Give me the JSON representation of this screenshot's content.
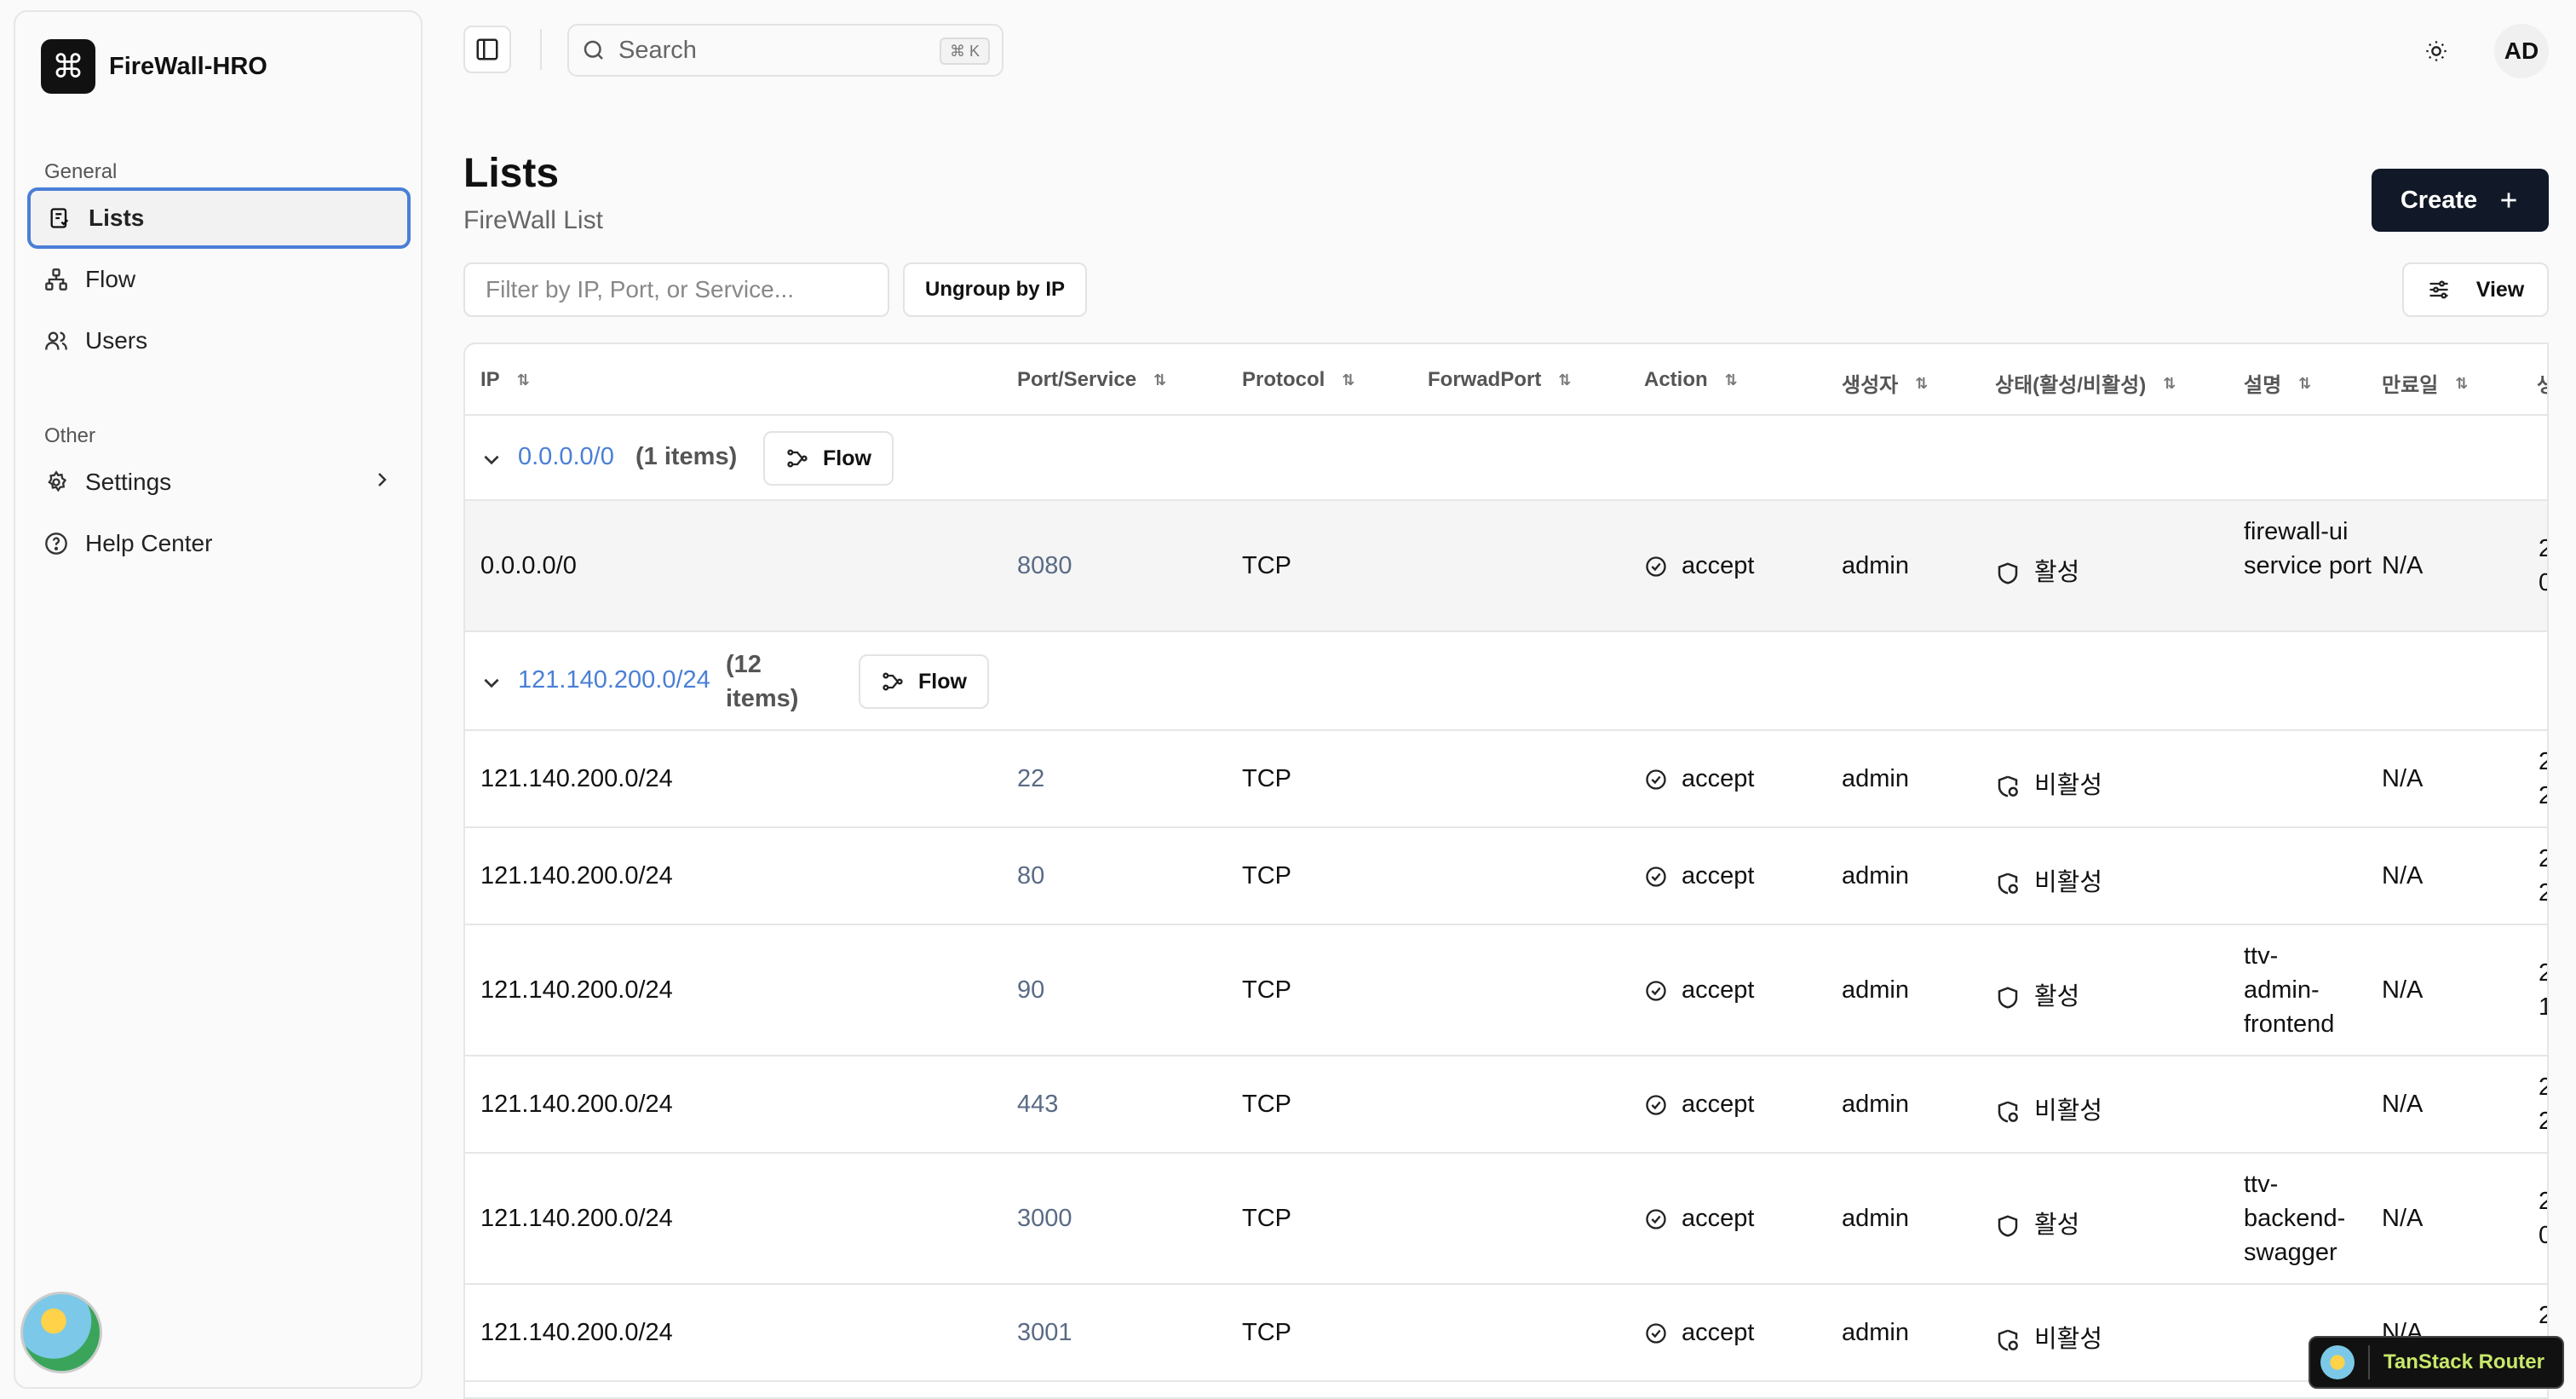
{
  "sidebar": {
    "brand_name": "FireWall-HRO",
    "brand_icon": "command-icon",
    "section_general": "General",
    "section_other": "Other",
    "items": [
      {
        "label": "Lists",
        "icon": "list-icon",
        "active": true
      },
      {
        "label": "Flow",
        "icon": "network-icon"
      },
      {
        "label": "Users",
        "icon": "users-icon"
      },
      {
        "label": "Settings",
        "icon": "gear-icon"
      },
      {
        "label": "Help Center",
        "icon": "help-icon"
      }
    ]
  },
  "topbar": {
    "search_label": "Search",
    "search_shortcut": "⌘ K",
    "user_initials": "AD"
  },
  "header": {
    "title": "Lists",
    "subtitle": "FireWall List",
    "create_label": "Create"
  },
  "toolbar": {
    "filter_placeholder": "Filter by IP, Port, or Service...",
    "ungroup_label": "Ungroup by IP",
    "view_label": "View"
  },
  "table": {
    "columns": [
      "IP",
      "Port/Service",
      "Protocol",
      "ForwadPort",
      "Action",
      "생성자",
      "상태(활성/비활성)",
      "설명",
      "만료일",
      "생"
    ],
    "groups": [
      {
        "ip": "0.0.0.0/0",
        "count_label": "(1 items)",
        "flow_label": "Flow",
        "rows": [
          {
            "ip": "0.0.0.0/0",
            "port": "8080",
            "protocol": "TCP",
            "action": "accept",
            "creator": "admin",
            "state": "활성",
            "desc": "firewall-ui service port",
            "expire": "N/A",
            "extra": "2 0"
          }
        ]
      },
      {
        "ip": "121.140.200.0/24",
        "count_label": "(12 items)",
        "flow_label": "Flow",
        "rows": [
          {
            "ip": "121.140.200.0/24",
            "port": "22",
            "protocol": "TCP",
            "action": "accept",
            "creator": "admin",
            "state": "비활성",
            "desc": "",
            "expire": "N/A",
            "extra": "2 2"
          },
          {
            "ip": "121.140.200.0/24",
            "port": "80",
            "protocol": "TCP",
            "action": "accept",
            "creator": "admin",
            "state": "비활성",
            "desc": "",
            "expire": "N/A",
            "extra": "2 2"
          },
          {
            "ip": "121.140.200.0/24",
            "port": "90",
            "protocol": "TCP",
            "action": "accept",
            "creator": "admin",
            "state": "활성",
            "desc": "ttv-admin-frontend",
            "expire": "N/A",
            "extra": "2 1"
          },
          {
            "ip": "121.140.200.0/24",
            "port": "443",
            "protocol": "TCP",
            "action": "accept",
            "creator": "admin",
            "state": "비활성",
            "desc": "",
            "expire": "N/A",
            "extra": "2 2"
          },
          {
            "ip": "121.140.200.0/24",
            "port": "3000",
            "protocol": "TCP",
            "action": "accept",
            "creator": "admin",
            "state": "활성",
            "desc": "ttv-backend-swagger",
            "expire": "N/A",
            "extra": "2 0"
          },
          {
            "ip": "121.140.200.0/24",
            "port": "3001",
            "protocol": "TCP",
            "action": "accept",
            "creator": "admin",
            "state": "비활성",
            "desc": "",
            "expire": "N/A",
            "extra": "2"
          }
        ]
      }
    ]
  },
  "devtools": {
    "label": "TanStack Router"
  }
}
